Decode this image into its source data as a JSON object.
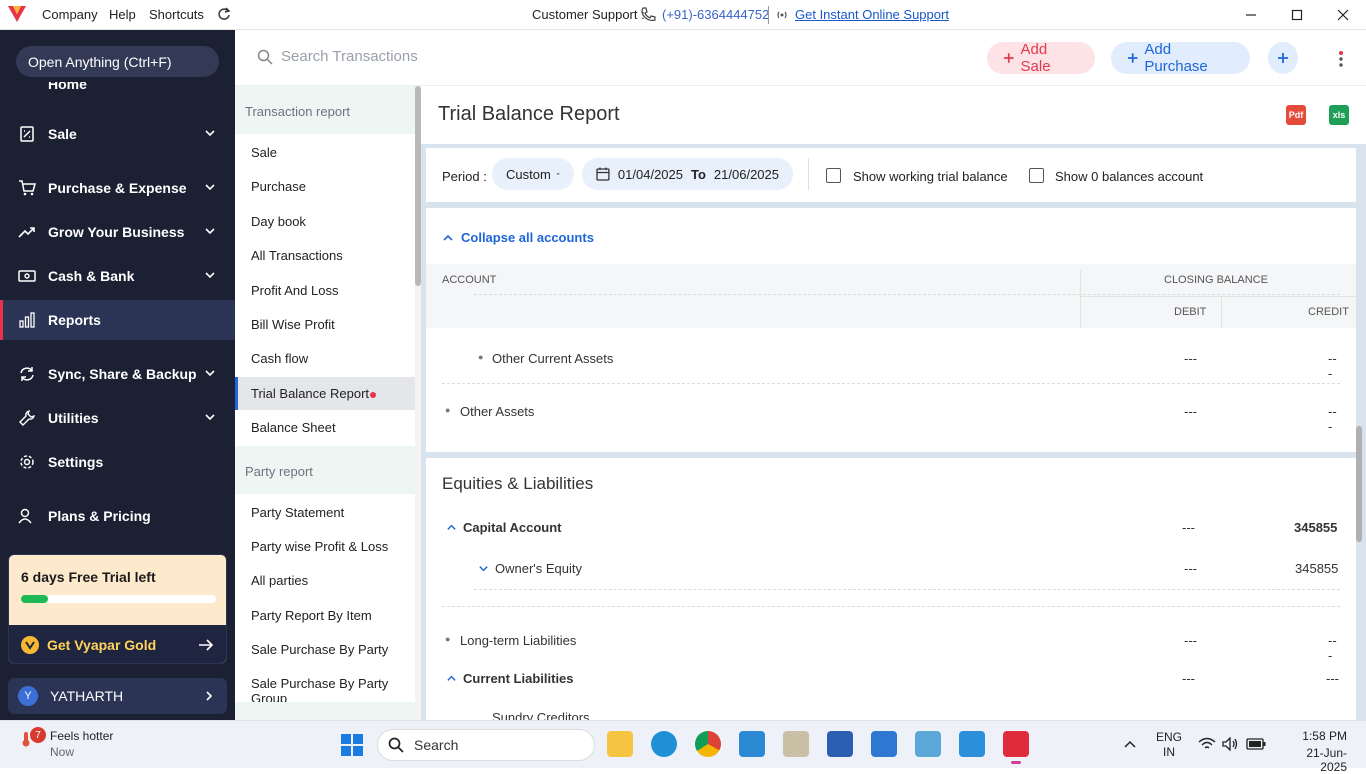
{
  "titlebar": {
    "menu": [
      "Company",
      "Help",
      "Shortcuts"
    ],
    "support_label": "Customer Support :",
    "phone": "(+91)-6364444752",
    "online_support": "Get Instant Online Support"
  },
  "sidebar": {
    "open_anything": "Open Anything (Ctrl+F)",
    "partial_item": "Home",
    "items": [
      {
        "label": "Sale",
        "icon": "receipt-icon",
        "has_chevron": true
      },
      {
        "label": "Purchase & Expense",
        "icon": "cart-icon",
        "has_chevron": true
      },
      {
        "label": "Grow Your Business",
        "icon": "trend-up-icon",
        "has_chevron": true
      },
      {
        "label": "Cash & Bank",
        "icon": "bank-icon",
        "has_chevron": true
      },
      {
        "label": "Reports",
        "icon": "bar-chart-icon",
        "has_chevron": false,
        "active": true
      },
      {
        "label": "Sync, Share & Backup",
        "icon": "sync-icon",
        "has_chevron": true
      },
      {
        "label": "Utilities",
        "icon": "wrench-icon",
        "has_chevron": true
      },
      {
        "label": "Settings",
        "icon": "gear-icon",
        "has_chevron": false
      },
      {
        "label": "Plans & Pricing",
        "icon": "users-icon",
        "has_chevron": false
      }
    ],
    "trial": {
      "text": "6 days Free Trial left",
      "progress": 0.14
    },
    "gold_button": "Get Vyapar Gold",
    "user": {
      "initial": "Y",
      "name": "YATHARTH"
    }
  },
  "header": {
    "search_placeholder": "Search Transactions",
    "add_sale": "Add Sale",
    "add_purchase": "Add Purchase"
  },
  "reports": {
    "transaction_header": "Transaction report",
    "transaction_items": [
      "Sale",
      "Purchase",
      "Day book",
      "All Transactions",
      "Profit And Loss",
      "Bill Wise Profit",
      "Cash flow",
      "Trial Balance Report",
      "Balance Sheet"
    ],
    "active_item": "Trial Balance Report",
    "party_header": "Party report",
    "party_items": [
      "Party Statement",
      "Party wise Profit & Loss",
      "All parties",
      "Party Report By Item",
      "Sale Purchase By Party",
      "Sale Purchase By Party Group"
    ]
  },
  "main": {
    "title": "Trial Balance Report",
    "pdf_label": "Pdf",
    "xls_label": "xls",
    "period_label": "Period :",
    "period_value": "Custom",
    "date_from": "01/04/2025",
    "date_to_label": "To",
    "date_to": "21/06/2025",
    "show_working": "Show working trial balance",
    "show_zero": "Show 0 balances account",
    "collapse_all": "Collapse all accounts",
    "columns": {
      "account": "ACCOUNT",
      "closing": "CLOSING BALANCE",
      "debit": "DEBIT",
      "credit": "CREDIT"
    },
    "asset_rows": [
      {
        "label": "Other Current Assets",
        "debit": "---",
        "credit": "---"
      },
      {
        "label": "Other Assets",
        "debit": "---",
        "credit": "---"
      }
    ],
    "equities_title": "Equities & Liabilities",
    "equity_rows": [
      {
        "label": "Capital Account",
        "debit": "---",
        "credit": "345855"
      },
      {
        "label": "Owner's Equity",
        "debit": "---",
        "credit": "345855"
      },
      {
        "label": "Long-term Liabilities",
        "debit": "---",
        "credit": "---"
      },
      {
        "label": "Current Liabilities",
        "debit": "---",
        "credit": "---"
      },
      {
        "label": "Sundry Creditors",
        "debit": "",
        "credit": ""
      }
    ]
  },
  "taskbar": {
    "weather_badge": "7",
    "weather_title": "Feels hotter",
    "weather_sub": "Now",
    "search": "Search",
    "lang_top": "ENG",
    "lang_bottom": "IN",
    "time": "1:58 PM",
    "date": "21-Jun-2025"
  },
  "colors": {
    "sidebar_bg": "#1b2033",
    "accent_red": "#e8344a",
    "accent_blue": "#1f66d9"
  }
}
